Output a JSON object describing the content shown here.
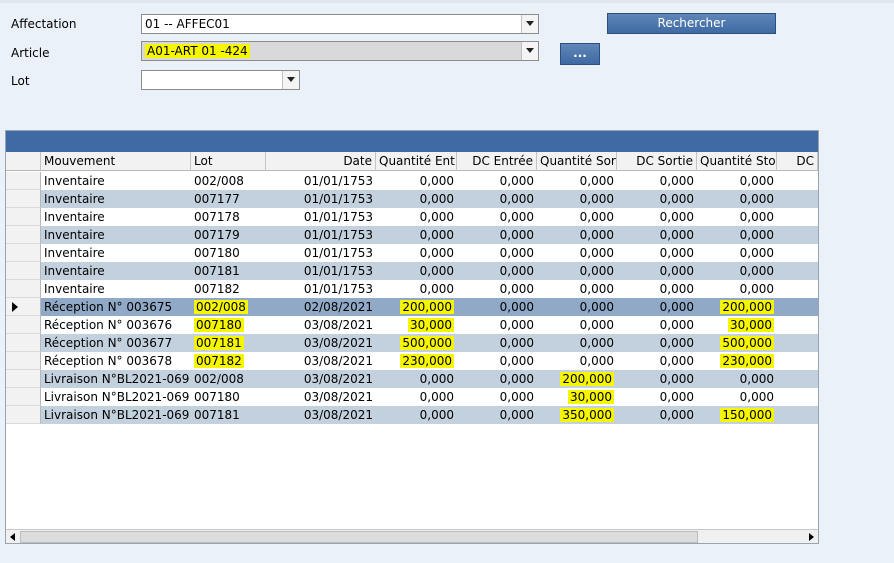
{
  "filters": {
    "affectation_label": "Affectation",
    "affectation_value": "01 -- AFFEC01",
    "article_label": "Article",
    "article_value": "A01-ART 01 -424",
    "lot_label": "Lot",
    "lot_value": ""
  },
  "buttons": {
    "search_label": "Rechercher",
    "dots_label": "..."
  },
  "table": {
    "columns": [
      "Mouvement",
      "Lot",
      "Date",
      "Quantité Ent",
      "DC Entrée",
      "Quantité Sor",
      "DC Sortie",
      "Quantité Sto",
      "DC"
    ],
    "rows": [
      {
        "mouvement": "Inventaire",
        "lot": "002/008",
        "date": "01/01/1753",
        "qte_ent": "0,000",
        "dc_ent": "0,000",
        "qte_sor": "0,000",
        "dc_sor": "0,000",
        "qte_sto": "0,000"
      },
      {
        "mouvement": "Inventaire",
        "lot": "007177",
        "date": "01/01/1753",
        "qte_ent": "0,000",
        "dc_ent": "0,000",
        "qte_sor": "0,000",
        "dc_sor": "0,000",
        "qte_sto": "0,000"
      },
      {
        "mouvement": "Inventaire",
        "lot": "007178",
        "date": "01/01/1753",
        "qte_ent": "0,000",
        "dc_ent": "0,000",
        "qte_sor": "0,000",
        "dc_sor": "0,000",
        "qte_sto": "0,000"
      },
      {
        "mouvement": "Inventaire",
        "lot": "007179",
        "date": "01/01/1753",
        "qte_ent": "0,000",
        "dc_ent": "0,000",
        "qte_sor": "0,000",
        "dc_sor": "0,000",
        "qte_sto": "0,000"
      },
      {
        "mouvement": "Inventaire",
        "lot": "007180",
        "date": "01/01/1753",
        "qte_ent": "0,000",
        "dc_ent": "0,000",
        "qte_sor": "0,000",
        "dc_sor": "0,000",
        "qte_sto": "0,000"
      },
      {
        "mouvement": "Inventaire",
        "lot": "007181",
        "date": "01/01/1753",
        "qte_ent": "0,000",
        "dc_ent": "0,000",
        "qte_sor": "0,000",
        "dc_sor": "0,000",
        "qte_sto": "0,000"
      },
      {
        "mouvement": "Inventaire",
        "lot": "007182",
        "date": "01/01/1753",
        "qte_ent": "0,000",
        "dc_ent": "0,000",
        "qte_sor": "0,000",
        "dc_sor": "0,000",
        "qte_sto": "0,000"
      },
      {
        "mouvement": "Réception N° 003675",
        "lot": "002/008",
        "date": "02/08/2021",
        "qte_ent": "200,000",
        "dc_ent": "0,000",
        "qte_sor": "0,000",
        "dc_sor": "0,000",
        "qte_sto": "200,000"
      },
      {
        "mouvement": "Réception N° 003676",
        "lot": "007180",
        "date": "03/08/2021",
        "qte_ent": "30,000",
        "dc_ent": "0,000",
        "qte_sor": "0,000",
        "dc_sor": "0,000",
        "qte_sto": "30,000"
      },
      {
        "mouvement": "Réception N° 003677",
        "lot": "007181",
        "date": "03/08/2021",
        "qte_ent": "500,000",
        "dc_ent": "0,000",
        "qte_sor": "0,000",
        "dc_sor": "0,000",
        "qte_sto": "500,000"
      },
      {
        "mouvement": "Réception N° 003678",
        "lot": "007182",
        "date": "03/08/2021",
        "qte_ent": "230,000",
        "dc_ent": "0,000",
        "qte_sor": "0,000",
        "dc_sor": "0,000",
        "qte_sto": "230,000"
      },
      {
        "mouvement": "Livraison N°BL2021-069",
        "lot": "002/008",
        "date": "03/08/2021",
        "qte_ent": "0,000",
        "dc_ent": "0,000",
        "qte_sor": "200,000",
        "dc_sor": "0,000",
        "qte_sto": "0,000"
      },
      {
        "mouvement": "Livraison N°BL2021-069",
        "lot": "007180",
        "date": "03/08/2021",
        "qte_ent": "0,000",
        "dc_ent": "0,000",
        "qte_sor": "30,000",
        "dc_sor": "0,000",
        "qte_sto": "0,000"
      },
      {
        "mouvement": "Livraison N°BL2021-069",
        "lot": "007181",
        "date": "03/08/2021",
        "qte_ent": "0,000",
        "dc_ent": "0,000",
        "qte_sor": "350,000",
        "dc_sor": "0,000",
        "qte_sto": "150,000"
      }
    ]
  },
  "colors": {
    "accent": "#3f6aa3",
    "highlight": "#f6f600",
    "row_alt": "#c3d1de",
    "row_selected": "#8fa9c6"
  }
}
